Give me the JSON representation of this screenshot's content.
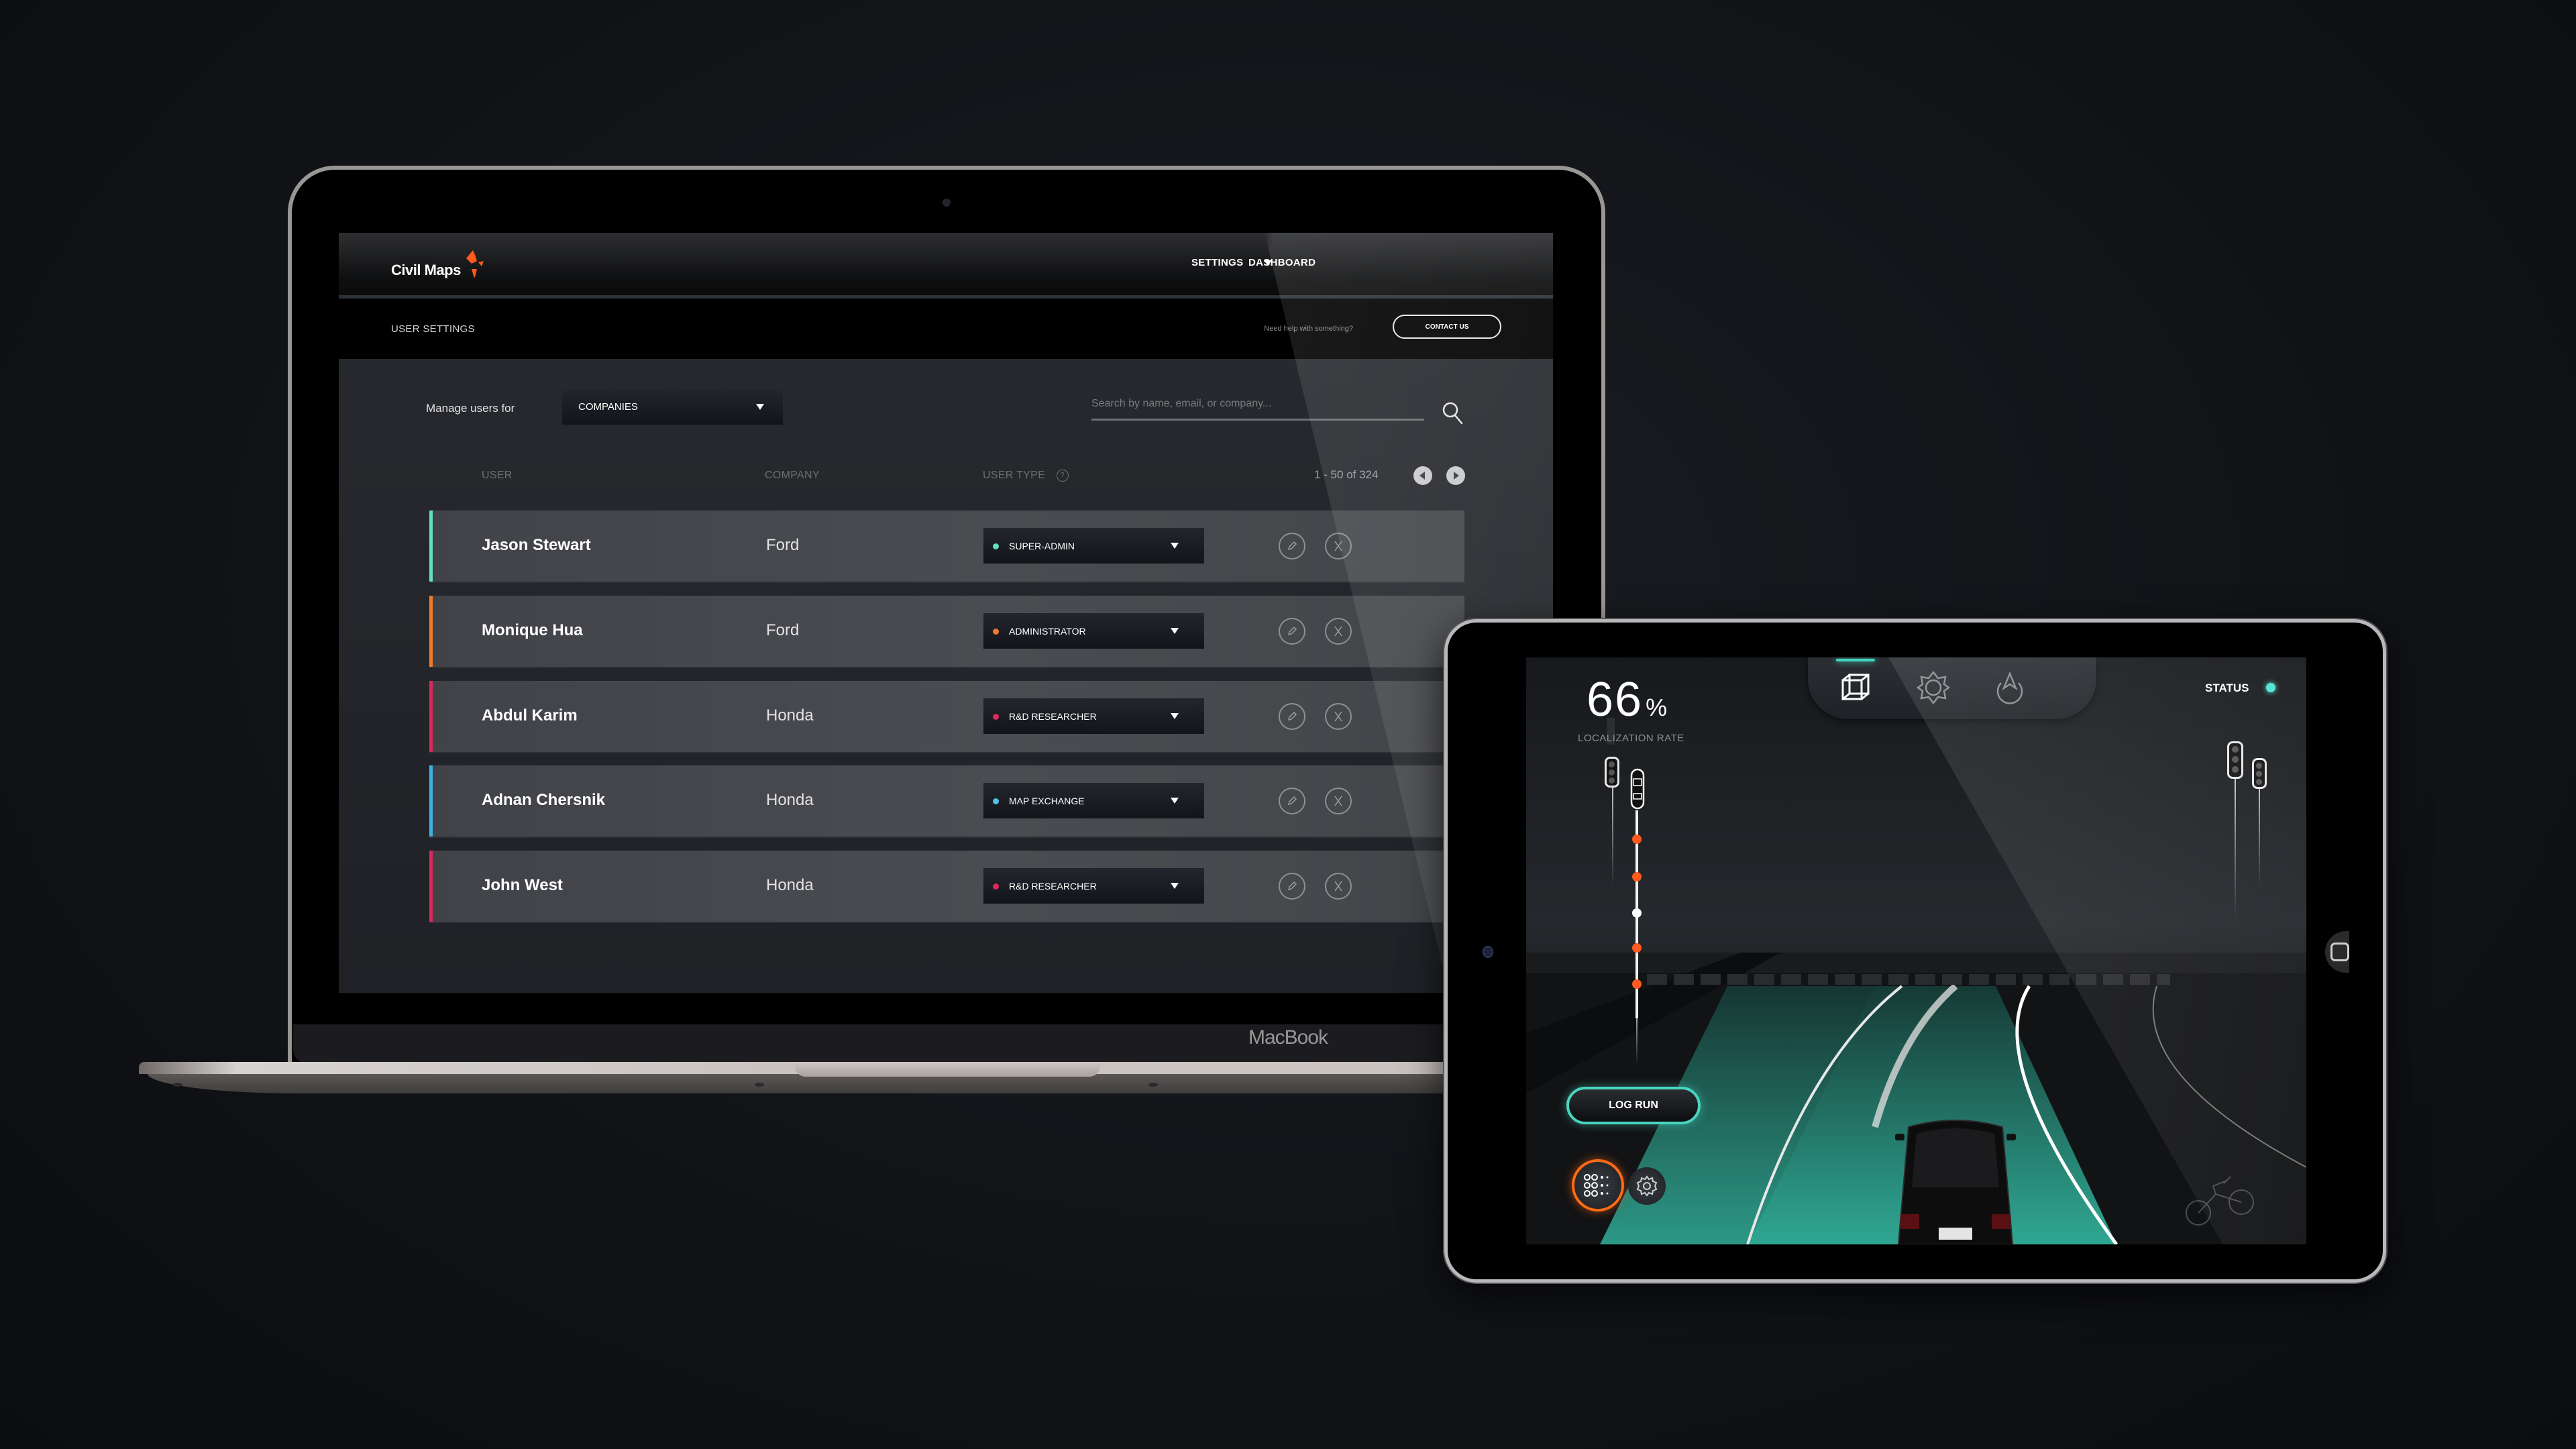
{
  "laptop": {
    "brand_label": "MacBook",
    "app": {
      "logo_text": "Civil Maps",
      "brand_color": "#ff5a1f",
      "nav": {
        "settings_label": "SETTINGS",
        "dashboard_label": "DASHBOARD"
      },
      "subheader": {
        "title": "USER SETTINGS",
        "help_text": "Need help with something?",
        "contact_label": "CONTACT US"
      },
      "filters": {
        "manage_label": "Manage users for",
        "scope_selected": "COMPANIES",
        "search_placeholder": "Search by name, email, or company..."
      },
      "table": {
        "columns": {
          "user": "USER",
          "company": "COMPANY",
          "user_type": "USER TYPE"
        },
        "pagination": "1 - 50 of 324",
        "rows": [
          {
            "name": "Jason Stewart",
            "company": "Ford",
            "role": "SUPER-ADMIN",
            "accent": "#5fe0c0",
            "role_color": "#5fe0c0"
          },
          {
            "name": "Monique Hua",
            "company": "Ford",
            "role": "ADMINISTRATOR",
            "accent": "#f07a2a",
            "role_color": "#f07a2a"
          },
          {
            "name": "Abdul Karim",
            "company": "Honda",
            "role": "R&D RESEARCHER",
            "accent": "#d9285d",
            "role_color": "#e0285e"
          },
          {
            "name": "Adnan Chersnik",
            "company": "Honda",
            "role": "MAP EXCHANGE",
            "accent": "#3fb0e6",
            "role_color": "#4fc3f0"
          },
          {
            "name": "John West",
            "company": "Honda",
            "role": "R&D RESEARCHER",
            "accent": "#d9285d",
            "role_color": "#e0285e"
          }
        ]
      }
    }
  },
  "tablet": {
    "localization": {
      "value": "66",
      "unit": "%",
      "label": "LOCALIZATION RATE"
    },
    "modes": [
      {
        "icon": "cube-icon",
        "active": true
      },
      {
        "icon": "sun-icon",
        "active": false
      },
      {
        "icon": "navigation-icon",
        "active": false
      }
    ],
    "status": {
      "label": "STATUS",
      "color": "#4fe3cf"
    },
    "log_run_label": "LOG RUN",
    "accent_color": "#49d6c1",
    "alert_color": "#ff5a1f",
    "route_markers": [
      "alert",
      "alert",
      "current",
      "alert",
      "alert"
    ]
  }
}
